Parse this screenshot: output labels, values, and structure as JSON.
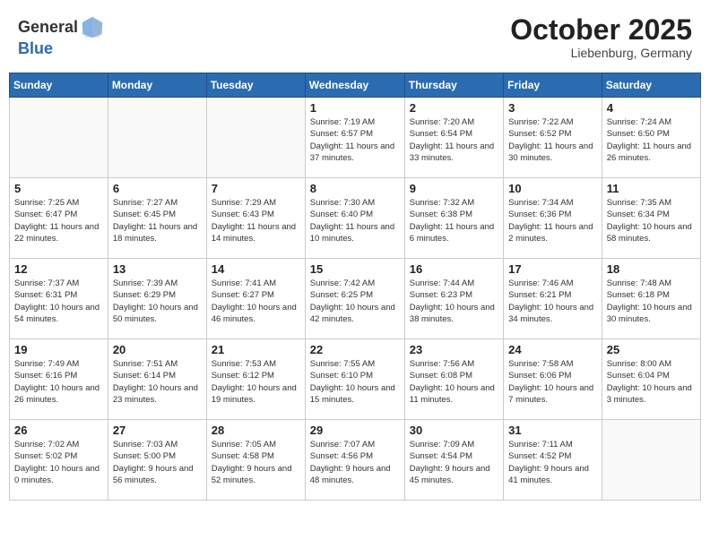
{
  "header": {
    "logo_general": "General",
    "logo_blue": "Blue",
    "title": "October 2025",
    "location": "Liebenburg, Germany"
  },
  "days_of_week": [
    "Sunday",
    "Monday",
    "Tuesday",
    "Wednesday",
    "Thursday",
    "Friday",
    "Saturday"
  ],
  "weeks": [
    [
      {
        "day": "",
        "info": ""
      },
      {
        "day": "",
        "info": ""
      },
      {
        "day": "",
        "info": ""
      },
      {
        "day": "1",
        "info": "Sunrise: 7:19 AM\nSunset: 6:57 PM\nDaylight: 11 hours and 37 minutes."
      },
      {
        "day": "2",
        "info": "Sunrise: 7:20 AM\nSunset: 6:54 PM\nDaylight: 11 hours and 33 minutes."
      },
      {
        "day": "3",
        "info": "Sunrise: 7:22 AM\nSunset: 6:52 PM\nDaylight: 11 hours and 30 minutes."
      },
      {
        "day": "4",
        "info": "Sunrise: 7:24 AM\nSunset: 6:50 PM\nDaylight: 11 hours and 26 minutes."
      }
    ],
    [
      {
        "day": "5",
        "info": "Sunrise: 7:25 AM\nSunset: 6:47 PM\nDaylight: 11 hours and 22 minutes."
      },
      {
        "day": "6",
        "info": "Sunrise: 7:27 AM\nSunset: 6:45 PM\nDaylight: 11 hours and 18 minutes."
      },
      {
        "day": "7",
        "info": "Sunrise: 7:29 AM\nSunset: 6:43 PM\nDaylight: 11 hours and 14 minutes."
      },
      {
        "day": "8",
        "info": "Sunrise: 7:30 AM\nSunset: 6:40 PM\nDaylight: 11 hours and 10 minutes."
      },
      {
        "day": "9",
        "info": "Sunrise: 7:32 AM\nSunset: 6:38 PM\nDaylight: 11 hours and 6 minutes."
      },
      {
        "day": "10",
        "info": "Sunrise: 7:34 AM\nSunset: 6:36 PM\nDaylight: 11 hours and 2 minutes."
      },
      {
        "day": "11",
        "info": "Sunrise: 7:35 AM\nSunset: 6:34 PM\nDaylight: 10 hours and 58 minutes."
      }
    ],
    [
      {
        "day": "12",
        "info": "Sunrise: 7:37 AM\nSunset: 6:31 PM\nDaylight: 10 hours and 54 minutes."
      },
      {
        "day": "13",
        "info": "Sunrise: 7:39 AM\nSunset: 6:29 PM\nDaylight: 10 hours and 50 minutes."
      },
      {
        "day": "14",
        "info": "Sunrise: 7:41 AM\nSunset: 6:27 PM\nDaylight: 10 hours and 46 minutes."
      },
      {
        "day": "15",
        "info": "Sunrise: 7:42 AM\nSunset: 6:25 PM\nDaylight: 10 hours and 42 minutes."
      },
      {
        "day": "16",
        "info": "Sunrise: 7:44 AM\nSunset: 6:23 PM\nDaylight: 10 hours and 38 minutes."
      },
      {
        "day": "17",
        "info": "Sunrise: 7:46 AM\nSunset: 6:21 PM\nDaylight: 10 hours and 34 minutes."
      },
      {
        "day": "18",
        "info": "Sunrise: 7:48 AM\nSunset: 6:18 PM\nDaylight: 10 hours and 30 minutes."
      }
    ],
    [
      {
        "day": "19",
        "info": "Sunrise: 7:49 AM\nSunset: 6:16 PM\nDaylight: 10 hours and 26 minutes."
      },
      {
        "day": "20",
        "info": "Sunrise: 7:51 AM\nSunset: 6:14 PM\nDaylight: 10 hours and 23 minutes."
      },
      {
        "day": "21",
        "info": "Sunrise: 7:53 AM\nSunset: 6:12 PM\nDaylight: 10 hours and 19 minutes."
      },
      {
        "day": "22",
        "info": "Sunrise: 7:55 AM\nSunset: 6:10 PM\nDaylight: 10 hours and 15 minutes."
      },
      {
        "day": "23",
        "info": "Sunrise: 7:56 AM\nSunset: 6:08 PM\nDaylight: 10 hours and 11 minutes."
      },
      {
        "day": "24",
        "info": "Sunrise: 7:58 AM\nSunset: 6:06 PM\nDaylight: 10 hours and 7 minutes."
      },
      {
        "day": "25",
        "info": "Sunrise: 8:00 AM\nSunset: 6:04 PM\nDaylight: 10 hours and 3 minutes."
      }
    ],
    [
      {
        "day": "26",
        "info": "Sunrise: 7:02 AM\nSunset: 5:02 PM\nDaylight: 10 hours and 0 minutes."
      },
      {
        "day": "27",
        "info": "Sunrise: 7:03 AM\nSunset: 5:00 PM\nDaylight: 9 hours and 56 minutes."
      },
      {
        "day": "28",
        "info": "Sunrise: 7:05 AM\nSunset: 4:58 PM\nDaylight: 9 hours and 52 minutes."
      },
      {
        "day": "29",
        "info": "Sunrise: 7:07 AM\nSunset: 4:56 PM\nDaylight: 9 hours and 48 minutes."
      },
      {
        "day": "30",
        "info": "Sunrise: 7:09 AM\nSunset: 4:54 PM\nDaylight: 9 hours and 45 minutes."
      },
      {
        "day": "31",
        "info": "Sunrise: 7:11 AM\nSunset: 4:52 PM\nDaylight: 9 hours and 41 minutes."
      },
      {
        "day": "",
        "info": ""
      }
    ]
  ]
}
